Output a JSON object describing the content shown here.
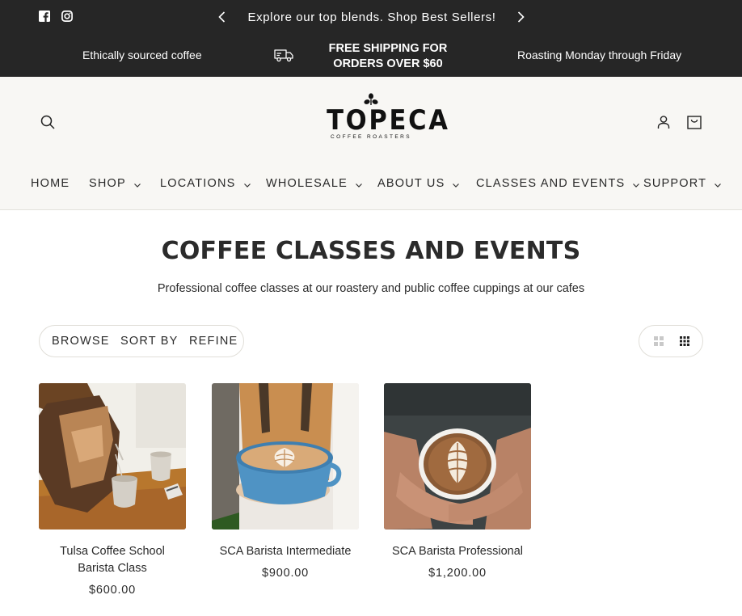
{
  "announcement": {
    "social": [
      {
        "name": "facebook-icon"
      },
      {
        "name": "instagram-icon"
      }
    ],
    "message": "Explore our top blends. Shop Best Sellers!",
    "prev_icon": "chevron-left-icon",
    "next_icon": "chevron-right-icon"
  },
  "perks": {
    "ethically": "Ethically sourced coffee",
    "shipping_line1": "FREE SHIPPING FOR",
    "shipping_line2": "ORDERS OVER $60",
    "roasting": "Roasting Monday through Friday"
  },
  "header": {
    "logo_word": "TOPECA",
    "logo_sub": "COFFEE ROASTERS",
    "icons": {
      "search": "search-icon",
      "account": "account-icon",
      "cart": "cart-icon"
    }
  },
  "nav": [
    {
      "label": "HOME",
      "has_menu": false
    },
    {
      "label": "SHOP",
      "has_menu": true
    },
    {
      "label": "LOCATIONS",
      "has_menu": true
    },
    {
      "label": "WHOLESALE",
      "has_menu": true
    },
    {
      "label": "ABOUT US",
      "has_menu": true
    },
    {
      "label": "CLASSES AND EVENTS",
      "has_menu": true
    },
    {
      "label": "SUPPORT",
      "has_menu": true
    }
  ],
  "main": {
    "title": "COFFEE CLASSES AND EVENTS",
    "subtitle": "Professional coffee classes at our roastery and public coffee cuppings at our cafes",
    "filters": {
      "browse": "BROWSE",
      "sort": "SORT BY",
      "refine": "REFINE"
    },
    "view_icons": [
      "grid-large-icon",
      "grid-small-icon"
    ]
  },
  "products": [
    {
      "title": "Tulsa Coffee School Barista Class",
      "price": "$600.00",
      "image": "pour-over-kettle-photo"
    },
    {
      "title": "SCA Barista Intermediate",
      "price": "$900.00",
      "image": "latte-art-blue-cup-photo"
    },
    {
      "title": "SCA Barista Professional",
      "price": "$1,200.00",
      "image": "latte-art-hands-photo"
    }
  ],
  "colors": {
    "topbar": "#262626",
    "header_bg": "#f8f7f4",
    "text": "#2a2a2a"
  }
}
